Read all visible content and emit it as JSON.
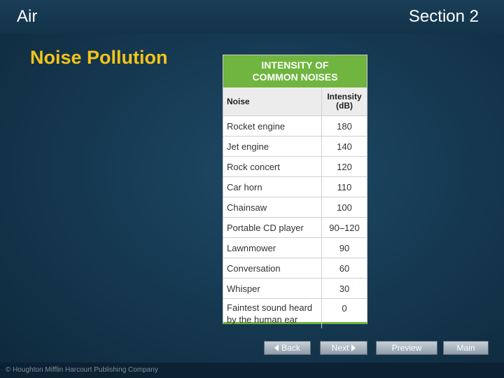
{
  "header": {
    "left_title": "Air",
    "right_title": "Section 2"
  },
  "slide": {
    "heading": "Noise Pollution"
  },
  "table": {
    "title_line1": "INTENSITY OF",
    "title_line2": "COMMON NOISES",
    "col_noise": "Noise",
    "col_intensity_line1": "Intensity",
    "col_intensity_line2": "(dB)",
    "rows": [
      {
        "noise": "Rocket engine",
        "intensity": "180"
      },
      {
        "noise": "Jet engine",
        "intensity": "140"
      },
      {
        "noise": "Rock concert",
        "intensity": "120"
      },
      {
        "noise": "Car horn",
        "intensity": "110"
      },
      {
        "noise": "Chainsaw",
        "intensity": "100"
      },
      {
        "noise": "Portable CD player",
        "intensity": "90–120"
      },
      {
        "noise": "Lawnmower",
        "intensity": "90"
      },
      {
        "noise": "Conversation",
        "intensity": "60"
      },
      {
        "noise": "Whisper",
        "intensity": "30"
      },
      {
        "noise": "Faintest sound heard by the human ear",
        "intensity": "0"
      }
    ],
    "accent_color": "#6fb53f"
  },
  "nav": {
    "back": "Back",
    "next": "Next",
    "preview": "Preview",
    "main": "Main"
  },
  "footer": {
    "copyright": "© Houghton Mifflin Harcourt Publishing Company"
  },
  "colors": {
    "heading": "#f3c419",
    "background": "#163a53"
  }
}
